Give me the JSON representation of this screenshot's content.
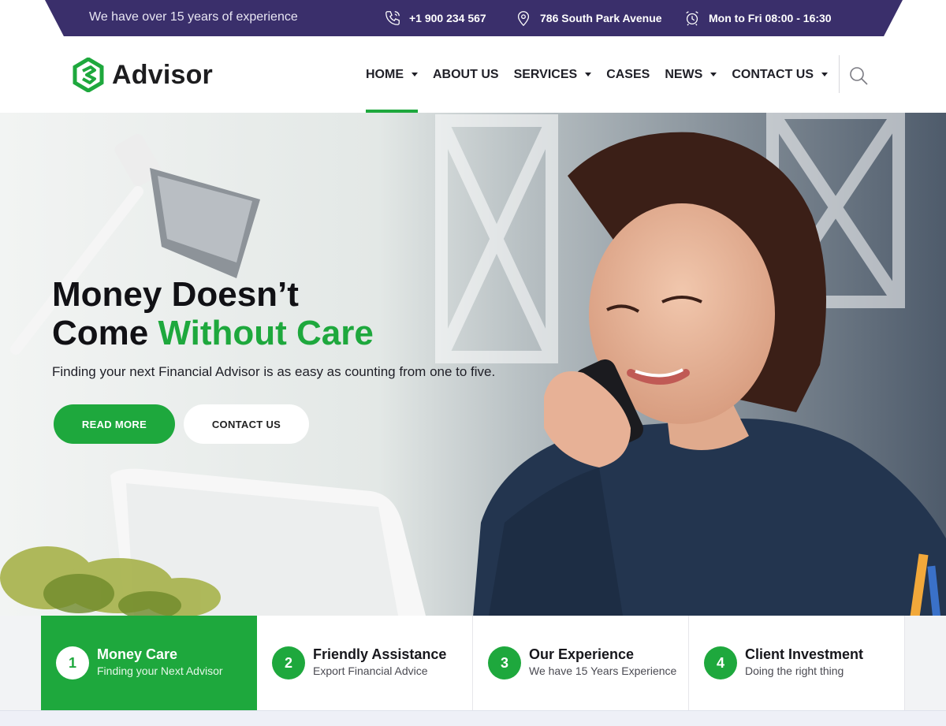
{
  "topbar": {
    "tagline": "We have over 15 years of experience",
    "phone": "+1 900 234 567",
    "address": "786 South Park Avenue",
    "hours": "Mon to Fri 08:00 - 16:30"
  },
  "header": {
    "logo_text": "Advisor",
    "nav": [
      {
        "label": "HOME",
        "dropdown": true,
        "active": true
      },
      {
        "label": "ABOUT US",
        "dropdown": false
      },
      {
        "label": "SERVICES",
        "dropdown": true
      },
      {
        "label": "CASES",
        "dropdown": false
      },
      {
        "label": "NEWS",
        "dropdown": true
      },
      {
        "label": "CONTACT US",
        "dropdown": true
      }
    ]
  },
  "hero": {
    "title_line1": "Money Doesn’t",
    "title_line2_prefix": "Come ",
    "title_line2_accent": "Without Care",
    "subtitle": "Finding your next Financial Advisor is as easy as counting from one to five.",
    "read_more": "READ MORE",
    "contact": "CONTACT US"
  },
  "features": [
    {
      "num": "1",
      "title": "Money Care",
      "subtitle": "Finding your Next Advisor",
      "active": true
    },
    {
      "num": "2",
      "title": "Friendly Assistance",
      "subtitle": "Export Financial Advice"
    },
    {
      "num": "3",
      "title": "Our Experience",
      "subtitle": "We have 15 Years Experience"
    },
    {
      "num": "4",
      "title": "Client Investment",
      "subtitle": "Doing the right thing"
    }
  ],
  "colors": {
    "accent": "#1ea83d",
    "topbar": "#3a2f6b",
    "dark_text": "#1f1f27"
  }
}
